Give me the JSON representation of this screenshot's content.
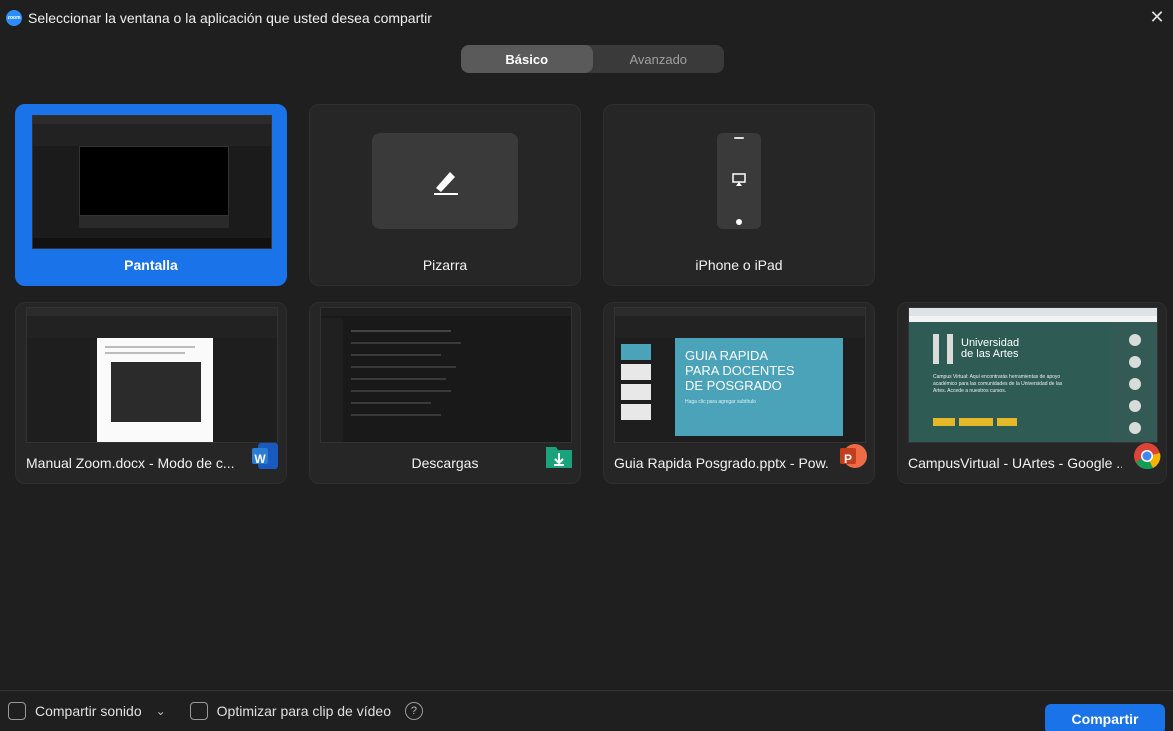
{
  "window": {
    "title": "Seleccionar la ventana o la aplicación que usted desea compartir",
    "app_icon_text": "zoom"
  },
  "tabs": [
    {
      "label": "Básico",
      "active": true
    },
    {
      "label": "Avanzado",
      "active": false
    }
  ],
  "tiles": [
    {
      "label": "Pantalla",
      "selected": true
    },
    {
      "label": "Pizarra"
    },
    {
      "label": "iPhone o iPad"
    },
    {
      "label": "Manual Zoom.docx  -  Modo de c...",
      "badge_text": "W"
    },
    {
      "label": "Descargas"
    },
    {
      "label": "Guia Rapida Posgrado.pptx - Pow...",
      "badge_text": "P"
    },
    {
      "label": "CampusVirtual - UArtes - Google ..."
    }
  ],
  "ppt_slide": {
    "title": "GUIA RAPIDA PARA DOCENTES DE POSGRADO",
    "subtitle": "Haga clic para agregar subtítulo"
  },
  "campus": {
    "logo_line1": "Universidad",
    "logo_line2": "de las Artes",
    "text": "Campus Virtual: Aquí encontrarás herramientas de apoyo académico para las comunidades de la Universidad de las Artes. Accede a nuestros cursos."
  },
  "bottom": {
    "share_sound": "Compartir sonido",
    "optimize_video": "Optimizar para clip de vídeo",
    "help": "?",
    "share_button": "Compartir"
  },
  "colors": {
    "accent": "#1a73e8",
    "background": "#1f1f1f",
    "tile": "#262626"
  }
}
